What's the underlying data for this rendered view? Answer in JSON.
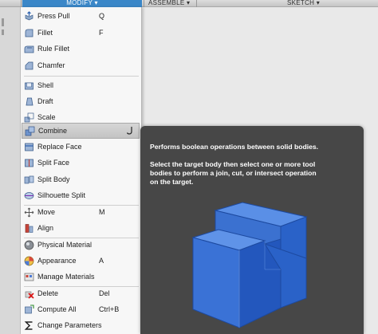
{
  "toolbar": {
    "tabs": [
      {
        "label": "MODIFY ▾"
      },
      {
        "label": "ASSEMBLE ▾"
      },
      {
        "label": "SKETCH ▾"
      }
    ]
  },
  "menu": {
    "items": [
      {
        "label": "Press Pull",
        "shortcut": "Q",
        "icon": "press-pull-icon"
      },
      {
        "label": "Fillet",
        "shortcut": "F",
        "icon": "fillet-icon"
      },
      {
        "label": "Rule Fillet",
        "shortcut": "",
        "icon": "rule-fillet-icon"
      },
      {
        "label": "Chamfer",
        "shortcut": "",
        "icon": "chamfer-icon"
      },
      {
        "label": "Shell",
        "shortcut": "",
        "icon": "shell-icon"
      },
      {
        "label": "Draft",
        "shortcut": "",
        "icon": "draft-icon"
      },
      {
        "label": "Scale",
        "shortcut": "",
        "icon": "scale-icon"
      },
      {
        "label": "Combine",
        "shortcut": "",
        "icon": "combine-icon"
      },
      {
        "label": "Replace Face",
        "shortcut": "",
        "icon": "replace-face-icon"
      },
      {
        "label": "Split Face",
        "shortcut": "",
        "icon": "split-face-icon"
      },
      {
        "label": "Split Body",
        "shortcut": "",
        "icon": "split-body-icon"
      },
      {
        "label": "Silhouette Split",
        "shortcut": "",
        "icon": "silhouette-split-icon"
      },
      {
        "label": "Move",
        "shortcut": "M",
        "icon": "move-icon"
      },
      {
        "label": "Align",
        "shortcut": "",
        "icon": "align-icon"
      },
      {
        "label": "Physical Material",
        "shortcut": "",
        "icon": "physical-material-icon"
      },
      {
        "label": "Appearance",
        "shortcut": "A",
        "icon": "appearance-icon"
      },
      {
        "label": "Manage Materials",
        "shortcut": "",
        "icon": "manage-materials-icon"
      },
      {
        "label": "Delete",
        "shortcut": "Del",
        "icon": "delete-icon"
      },
      {
        "label": "Compute All",
        "shortcut": "Ctrl+B",
        "icon": "compute-all-icon"
      },
      {
        "label": "Change Parameters",
        "shortcut": "",
        "icon": "change-parameters-icon"
      }
    ],
    "highlighted": "Combine"
  },
  "tooltip": {
    "line1": "Performs boolean operations between solid bodies.",
    "line2": "Select the target body then select one or more tool",
    "line3": "bodies to perform a join, cut, or intersect operation",
    "line4": "on the target."
  },
  "colors": {
    "accent": "#3a87c8",
    "tooltip_bg": "#474747",
    "body_blue": "#2f6fd0"
  }
}
